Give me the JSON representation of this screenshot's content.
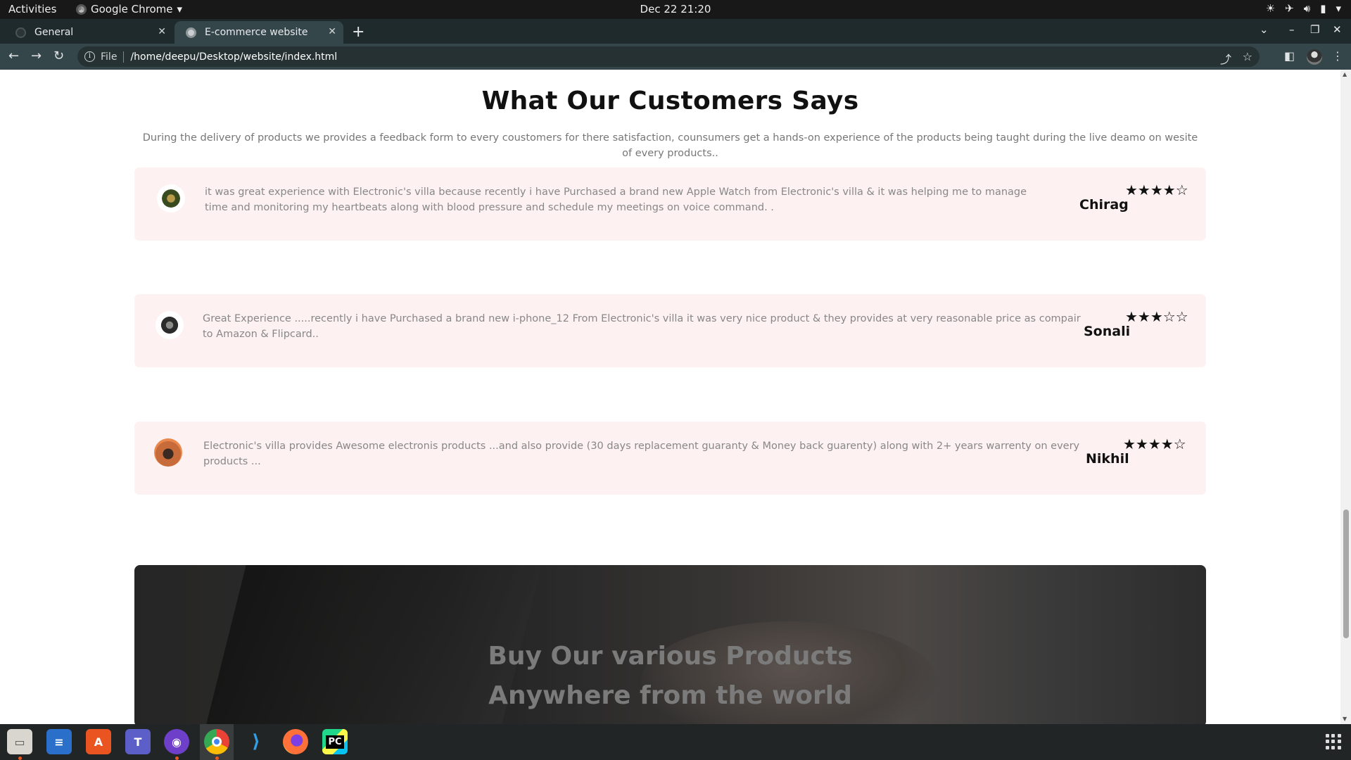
{
  "system": {
    "activities": "Activities",
    "app_menu": "Google Chrome",
    "clock": "Dec 22  21:20"
  },
  "browser": {
    "tabs": [
      {
        "label": "General"
      },
      {
        "label": "E-commerce website"
      }
    ],
    "address": {
      "scheme": "File",
      "url": "/home/deepu/Desktop/website/index.html"
    }
  },
  "page": {
    "heading": "What Our Customers Says",
    "intro": "During the delivery of products we provides a feedback form to every coustomers for there satisfaction, counsumers get a hands-on experience of the products being taught during the live deamo on wesite of every products..",
    "reviews": [
      {
        "text": "it was great experience with Electronic's villa because recently i have Purchased a brand new Apple Watch from Electronic's villa & it was helping me to manage time and monitoring my heartbeats along with blood pressure and schedule my meetings on voice command. .",
        "name": "Chirag",
        "rating": 4,
        "stars_filled": "★★★★",
        "stars_empty": "☆"
      },
      {
        "text": "Great Experience .....recently i have Purchased a brand new i-phone_12 From Electronic's villa it was very nice product & they provides at very reasonable price as compair to Amazon & Flipcard..",
        "name": "Sonali",
        "rating": 3,
        "stars_filled": "★★★",
        "stars_empty": "☆☆"
      },
      {
        "text": "Electronic's villa provides Awesome electronis products ...and also provide (30 days replacement guaranty & Money back guarenty) along with 2+ years warrenty on every products ...",
        "name": "Nikhil",
        "rating": 4,
        "stars_filled": "★★★★",
        "stars_empty": "☆"
      }
    ],
    "banner": {
      "line1": "Buy Our various Products",
      "line2": "Anywhere from the world"
    }
  },
  "dock": {
    "apps": [
      "files",
      "text-editor",
      "software-center",
      "teams",
      "github-desktop",
      "chrome",
      "vscode",
      "firefox",
      "pycharm"
    ],
    "vscode_glyph": "⟩",
    "pycharm_label": "PC"
  },
  "colors": {
    "review_bg": "#fdf1f1",
    "tab_active": "#35464a",
    "dock_indicator": "#e95420"
  }
}
